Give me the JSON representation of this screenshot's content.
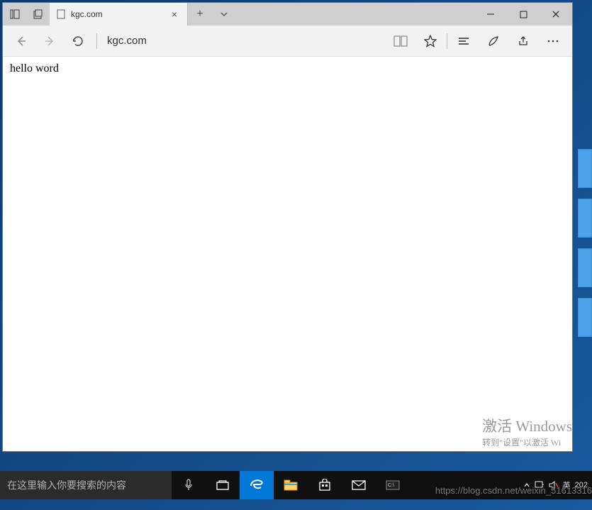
{
  "browser": {
    "tab": {
      "title": "kgc.com"
    },
    "address": "kgc.com",
    "page_content": "hello word"
  },
  "activate": {
    "title": "激活 Windows",
    "subtitle": "转到\"设置\"以激活 Wi"
  },
  "taskbar": {
    "search_placeholder": "在这里输入你要搜索的内容",
    "tray": {
      "ime": "英",
      "time": "202"
    }
  },
  "watermark": "https://blog.csdn.net/weixin_51613316"
}
